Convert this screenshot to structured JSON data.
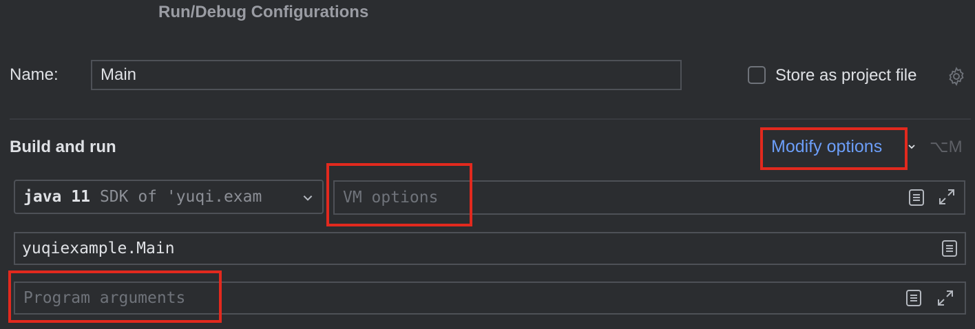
{
  "dialog": {
    "title": "Run/Debug Configurations"
  },
  "name": {
    "label": "Name:",
    "value": "Main"
  },
  "store": {
    "label": "Store as project file",
    "checked": false
  },
  "build_run": {
    "title": "Build and run",
    "modify_options": "Modify options",
    "shortcut": "⌥M",
    "sdk": {
      "version": "java 11",
      "description": "SDK of 'yuqi.exam"
    },
    "vm_options": {
      "value": "",
      "placeholder": "VM options"
    },
    "main_class": {
      "value": "yuqiexample.Main"
    },
    "program_args": {
      "value": "",
      "placeholder": "Program arguments"
    }
  },
  "colors": {
    "background": "#2b2d30",
    "link": "#6c9ef8",
    "highlight": "#e2291e",
    "border": "#4e5157"
  },
  "icons": [
    "gear-icon",
    "chevron-down-icon",
    "document-icon",
    "expand-icon"
  ]
}
